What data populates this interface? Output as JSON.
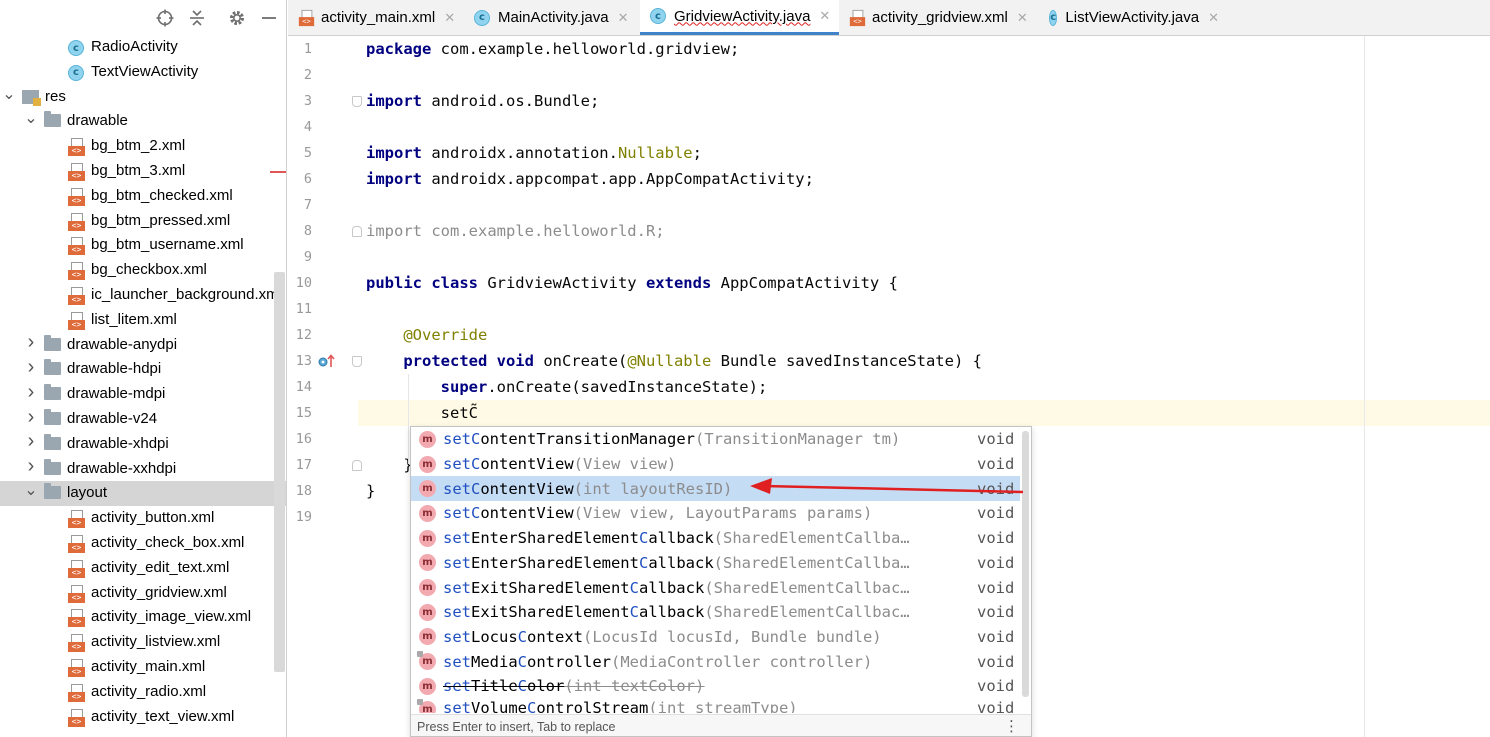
{
  "project_tree": {
    "rows": [
      {
        "label": "RadioActivity",
        "icon": "class",
        "indent": 2
      },
      {
        "label": "TextViewActivity",
        "icon": "class",
        "indent": 2
      },
      {
        "label": "res",
        "icon": "res-folder",
        "indent": 0,
        "expanded": true
      },
      {
        "label": "drawable",
        "icon": "folder",
        "indent": 1,
        "expanded": true
      },
      {
        "label": "bg_btm_2.xml",
        "icon": "xml",
        "indent": 2
      },
      {
        "label": "bg_btm_3.xml",
        "icon": "xml",
        "indent": 2
      },
      {
        "label": "bg_btm_checked.xml",
        "icon": "xml",
        "indent": 2
      },
      {
        "label": "bg_btm_pressed.xml",
        "icon": "xml",
        "indent": 2
      },
      {
        "label": "bg_btm_username.xml",
        "icon": "xml",
        "indent": 2
      },
      {
        "label": "bg_checkbox.xml",
        "icon": "xml",
        "indent": 2
      },
      {
        "label": "ic_launcher_background.xml",
        "icon": "xml",
        "indent": 2
      },
      {
        "label": "list_litem.xml",
        "icon": "xml",
        "indent": 2
      },
      {
        "label": "drawable-anydpi",
        "icon": "folder",
        "indent": 1,
        "expanded": false
      },
      {
        "label": "drawable-hdpi",
        "icon": "folder",
        "indent": 1,
        "expanded": false
      },
      {
        "label": "drawable-mdpi",
        "icon": "folder",
        "indent": 1,
        "expanded": false
      },
      {
        "label": "drawable-v24",
        "icon": "folder",
        "indent": 1,
        "expanded": false
      },
      {
        "label": "drawable-xhdpi",
        "icon": "folder",
        "indent": 1,
        "expanded": false
      },
      {
        "label": "drawable-xxhdpi",
        "icon": "folder",
        "indent": 1,
        "expanded": false
      },
      {
        "label": "layout",
        "icon": "folder",
        "indent": 1,
        "expanded": true,
        "selected": true
      },
      {
        "label": "activity_button.xml",
        "icon": "xml",
        "indent": 2
      },
      {
        "label": "activity_check_box.xml",
        "icon": "xml",
        "indent": 2
      },
      {
        "label": "activity_edit_text.xml",
        "icon": "xml",
        "indent": 2
      },
      {
        "label": "activity_gridview.xml",
        "icon": "xml",
        "indent": 2
      },
      {
        "label": "activity_image_view.xml",
        "icon": "xml",
        "indent": 2
      },
      {
        "label": "activity_listview.xml",
        "icon": "xml",
        "indent": 2
      },
      {
        "label": "activity_main.xml",
        "icon": "xml",
        "indent": 2
      },
      {
        "label": "activity_radio.xml",
        "icon": "xml",
        "indent": 2
      },
      {
        "label": "activity_text_view.xml",
        "icon": "xml",
        "indent": 2
      }
    ]
  },
  "tabs": [
    {
      "label": "activity_main.xml",
      "icon": "xml",
      "active": false
    },
    {
      "label": "MainActivity.java",
      "icon": "class",
      "active": false
    },
    {
      "label": "GridviewActivity.java",
      "icon": "class",
      "active": true
    },
    {
      "label": "activity_gridview.xml",
      "icon": "xml",
      "active": false
    },
    {
      "label": "ListViewActivity.java",
      "icon": "class",
      "active": false
    }
  ],
  "editor": {
    "current_line": 15,
    "lines": [
      {
        "n": "1",
        "code": [
          {
            "t": "package",
            "c": "kw"
          },
          {
            "t": " com.example.helloworld.gridview;"
          }
        ]
      },
      {
        "n": "2",
        "code": []
      },
      {
        "n": "3",
        "code": [
          {
            "t": "import",
            "c": "kw"
          },
          {
            "t": " android.os.Bundle;"
          }
        ]
      },
      {
        "n": "4",
        "code": []
      },
      {
        "n": "5",
        "code": [
          {
            "t": "import",
            "c": "kw"
          },
          {
            "t": " androidx.annotation."
          },
          {
            "t": "Nullable",
            "c": "ann"
          },
          {
            "t": ";"
          }
        ]
      },
      {
        "n": "6",
        "code": [
          {
            "t": "import",
            "c": "kw"
          },
          {
            "t": " androidx.appcompat.app.AppCompatActivity;"
          }
        ]
      },
      {
        "n": "7",
        "code": []
      },
      {
        "n": "8",
        "code": [
          {
            "t": "import com.example.helloworld.R;",
            "c": "unused"
          }
        ]
      },
      {
        "n": "9",
        "code": []
      },
      {
        "n": "10",
        "code": [
          {
            "t": "public class",
            "c": "kw"
          },
          {
            "t": " GridviewActivity "
          },
          {
            "t": "extends",
            "c": "kw"
          },
          {
            "t": " AppCompatActivity {"
          }
        ]
      },
      {
        "n": "11",
        "code": []
      },
      {
        "n": "12",
        "code": [
          {
            "t": "    "
          },
          {
            "t": "@Override",
            "c": "ann"
          }
        ]
      },
      {
        "n": "13",
        "code": [
          {
            "t": "    "
          },
          {
            "t": "protected void",
            "c": "kw"
          },
          {
            "t": " onCreate("
          },
          {
            "t": "@Nullable",
            "c": "ann"
          },
          {
            "t": " Bundle savedInstanceState) {"
          }
        ]
      },
      {
        "n": "14",
        "code": [
          {
            "t": "        "
          },
          {
            "t": "super",
            "c": "kw"
          },
          {
            "t": ".onCreate(savedInstanceState);"
          }
        ]
      },
      {
        "n": "15",
        "code": [
          {
            "t": "        setC"
          },
          {
            "t": "̃",
            "c": "typing-mark"
          }
        ]
      },
      {
        "n": "16",
        "code": []
      },
      {
        "n": "17",
        "code": [
          {
            "t": "    }"
          }
        ]
      },
      {
        "n": "18",
        "code": [
          {
            "t": "}"
          }
        ]
      },
      {
        "n": "19",
        "code": []
      }
    ]
  },
  "completion": {
    "typed_prefix": "setC",
    "items": [
      {
        "name": [
          "set",
          "Content",
          "TransitionManager"
        ],
        "params": "(TransitionManager tm)",
        "type": "void"
      },
      {
        "name": [
          "set",
          "Content",
          "View"
        ],
        "params": "(View view)",
        "type": "void"
      },
      {
        "name": [
          "set",
          "Content",
          "View"
        ],
        "params": "(int layoutResID)",
        "type": "void",
        "selected": true
      },
      {
        "name": [
          "set",
          "Content",
          "View"
        ],
        "params": "(View view, LayoutParams params)",
        "type": "void"
      },
      {
        "name": [
          "set",
          "EnterSharedElement",
          "Callback"
        ],
        "params": "(SharedElementCallba…",
        "type": "void"
      },
      {
        "name": [
          "set",
          "EnterSharedElement",
          "Callback"
        ],
        "params": "(SharedElementCallba…",
        "type": "void"
      },
      {
        "name": [
          "set",
          "ExitSharedElement",
          "Callback"
        ],
        "params": "(SharedElementCallbac…",
        "type": "void"
      },
      {
        "name": [
          "set",
          "ExitSharedElement",
          "Callback"
        ],
        "params": "(SharedElementCallbac…",
        "type": "void"
      },
      {
        "name": [
          "set",
          "Locus",
          "Context"
        ],
        "params": "(LocusId locusId, Bundle bundle)",
        "type": "void"
      },
      {
        "name": [
          "set",
          "MediaController",
          ""
        ],
        "params": "(MediaController controller)",
        "type": "void",
        "lock": true
      },
      {
        "name": [
          "set",
          "TitleColor",
          ""
        ],
        "params": "(int textColor)",
        "type": "void",
        "deprecated": true
      },
      {
        "name": [
          "set",
          "VolumeControlStream",
          ""
        ],
        "params": "(int streamType)",
        "type": "void",
        "lock": true,
        "cut": true
      }
    ],
    "footer_text": "Press Enter to insert, Tab to replace",
    "more_icon": "vertical-dots-icon"
  },
  "colors": {
    "keyword": "#000080",
    "annotation": "#808000",
    "selection": "#c5dcf5",
    "active_tab_underline": "#4083c9",
    "arrow": "#e02020"
  }
}
